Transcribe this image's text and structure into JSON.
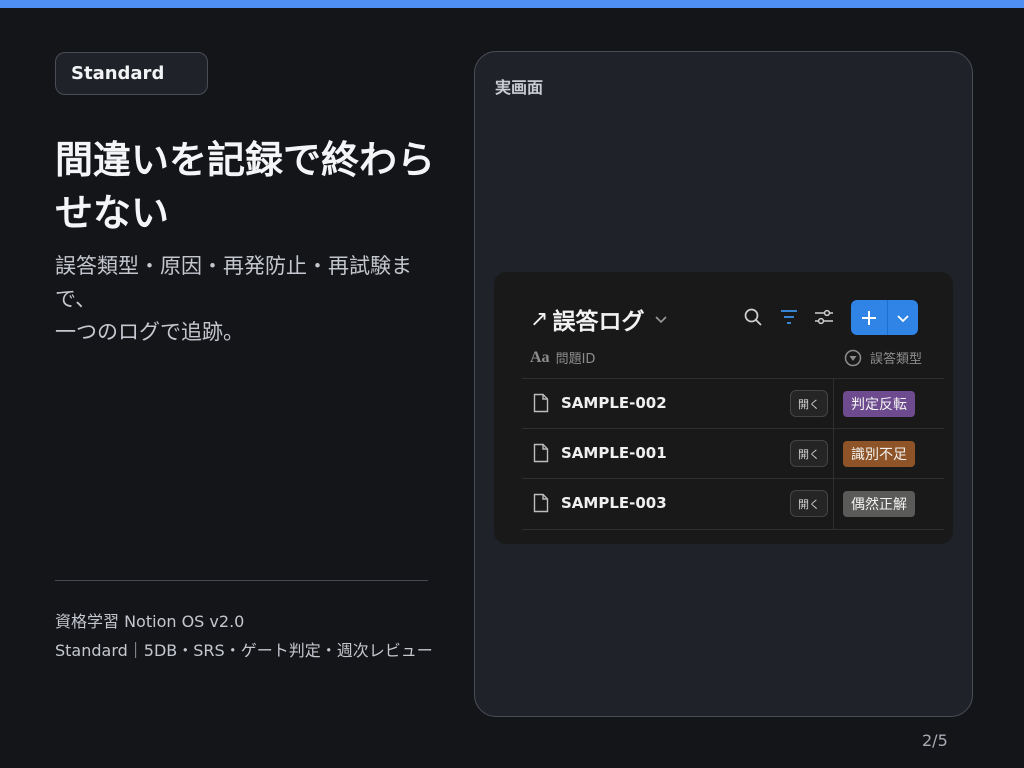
{
  "badge": "Standard",
  "headline": "間違いを記録で終わらせない",
  "lead": [
    "誤答類型・原因・再発防止・再試験ま",
    "で、",
    "一つのログで追跡。"
  ],
  "footer": {
    "line1": "資格学習 Notion OS v2.0",
    "line2": "Standard｜5DB・SRS・ゲート判定・週次レビュー"
  },
  "page_number": "2/5",
  "screen": {
    "label": "実画面",
    "database": {
      "title_arrow": "↗",
      "title": "誤答ログ",
      "icons": [
        "link-arrow-icon",
        "chevron-down-icon",
        "search-icon",
        "filter-icon",
        "settings-sliders-icon",
        "plus-icon",
        "chevron-down-icon"
      ],
      "columns": {
        "id": "問題ID",
        "id_icon": "Aa",
        "type": "誤答類型"
      },
      "rows": [
        {
          "id": "SAMPLE-002",
          "open": "開く",
          "tag": "判定反転",
          "tag_color": "#6e4a8f"
        },
        {
          "id": "SAMPLE-001",
          "open": "開く",
          "tag": "識別不足",
          "tag_color": "#8e5428"
        },
        {
          "id": "SAMPLE-003",
          "open": "開く",
          "tag": "偶然正解",
          "tag_color": "#5a5a58"
        }
      ]
    }
  },
  "colors": {
    "accent": "#4f8ff3",
    "background": "#141519",
    "button_blue": "#2f84e5"
  }
}
